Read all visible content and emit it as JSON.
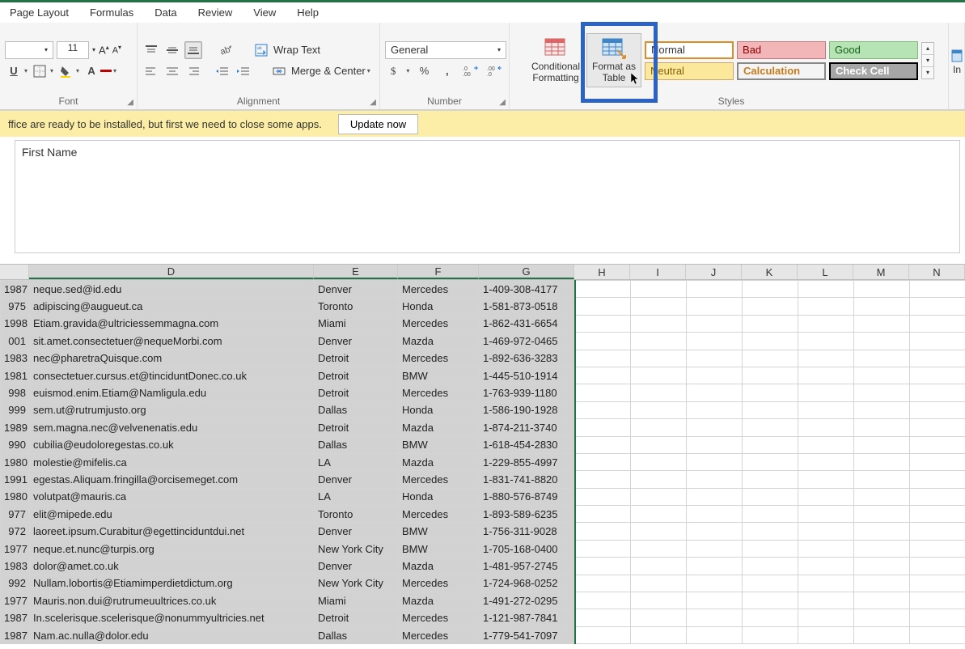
{
  "tabs": [
    "Page Layout",
    "Formulas",
    "Data",
    "Review",
    "View",
    "Help"
  ],
  "ribbon": {
    "font": {
      "size": "11",
      "label": "Font"
    },
    "alignment": {
      "wrap_text": "Wrap Text",
      "merge_center": "Merge & Center",
      "label": "Alignment"
    },
    "number": {
      "format": "General",
      "label": "Number"
    },
    "conditionalFormatting": "Conditional\nFormatting",
    "formatAsTable": "Format as\nTable",
    "styles": {
      "normal": "Normal",
      "bad": "Bad",
      "good": "Good",
      "neutral": "Neutral",
      "calculation": "Calculation",
      "checkcell": "Check Cell",
      "label": "Styles"
    },
    "insert_cut": "In"
  },
  "messagebar": {
    "text": "ffice are ready to be installed, but first we need to close some apps.",
    "button": "Update now"
  },
  "formula_bar_value": "First Name",
  "columns_visible": [
    "",
    "D",
    "E",
    "F",
    "G",
    "H",
    "I",
    "J",
    "K",
    "L",
    "M",
    "N"
  ],
  "rows": [
    {
      "yr": "1987",
      "email": "neque.sed@id.edu",
      "city": "Denver",
      "make": "Mercedes",
      "phone": "1-409-308-4177"
    },
    {
      "yr": "975",
      "email": "adipiscing@augueut.ca",
      "city": "Toronto",
      "make": "Honda",
      "phone": "1-581-873-0518"
    },
    {
      "yr": "1998",
      "email": "Etiam.gravida@ultriciessemmagna.com",
      "city": "Miami",
      "make": "Mercedes",
      "phone": "1-862-431-6654"
    },
    {
      "yr": "001",
      "email": "sit.amet.consectetuer@nequeMorbi.com",
      "city": "Denver",
      "make": "Mazda",
      "phone": "1-469-972-0465"
    },
    {
      "yr": "1983",
      "email": "nec@pharetraQuisque.com",
      "city": "Detroit",
      "make": "Mercedes",
      "phone": "1-892-636-3283"
    },
    {
      "yr": "1981",
      "email": "consectetuer.cursus.et@tinciduntDonec.co.uk",
      "city": "Detroit",
      "make": "BMW",
      "phone": "1-445-510-1914"
    },
    {
      "yr": "998",
      "email": "euismod.enim.Etiam@Namligula.edu",
      "city": "Detroit",
      "make": "Mercedes",
      "phone": "1-763-939-1180"
    },
    {
      "yr": "999",
      "email": "sem.ut@rutrumjusto.org",
      "city": "Dallas",
      "make": "Honda",
      "phone": "1-586-190-1928"
    },
    {
      "yr": "1989",
      "email": "sem.magna.nec@velvenenatis.edu",
      "city": "Detroit",
      "make": "Mazda",
      "phone": "1-874-211-3740"
    },
    {
      "yr": "990",
      "email": "cubilia@eudoloregestas.co.uk",
      "city": "Dallas",
      "make": "BMW",
      "phone": "1-618-454-2830"
    },
    {
      "yr": "1980",
      "email": "molestie@mifelis.ca",
      "city": "LA",
      "make": "Mazda",
      "phone": "1-229-855-4997"
    },
    {
      "yr": "1991",
      "email": "egestas.Aliquam.fringilla@orcisemeget.com",
      "city": "Denver",
      "make": "Mercedes",
      "phone": "1-831-741-8820"
    },
    {
      "yr": "1980",
      "email": "volutpat@mauris.ca",
      "city": "LA",
      "make": "Honda",
      "phone": "1-880-576-8749"
    },
    {
      "yr": "977",
      "email": "elit@mipede.edu",
      "city": "Toronto",
      "make": "Mercedes",
      "phone": "1-893-589-6235"
    },
    {
      "yr": "972",
      "email": "laoreet.ipsum.Curabitur@egettinciduntdui.net",
      "city": "Denver",
      "make": "BMW",
      "phone": "1-756-311-9028"
    },
    {
      "yr": "1977",
      "email": "neque.et.nunc@turpis.org",
      "city": "New York City",
      "make": "BMW",
      "phone": "1-705-168-0400"
    },
    {
      "yr": "1983",
      "email": "dolor@amet.co.uk",
      "city": "Denver",
      "make": "Mazda",
      "phone": "1-481-957-2745"
    },
    {
      "yr": "992",
      "email": "Nullam.lobortis@Etiamimperdietdictum.org",
      "city": "New York City",
      "make": "Mercedes",
      "phone": "1-724-968-0252"
    },
    {
      "yr": "1977",
      "email": "Mauris.non.dui@rutrumeuultrices.co.uk",
      "city": "Miami",
      "make": "Mazda",
      "phone": "1-491-272-0295"
    },
    {
      "yr": "1987",
      "email": "In.scelerisque.scelerisque@nonummyultricies.net",
      "city": "Detroit",
      "make": "Mercedes",
      "phone": "1-121-987-7841"
    },
    {
      "yr": "1987",
      "email": "Nam.ac.nulla@dolor.edu",
      "city": "Dallas",
      "make": "Mercedes",
      "phone": "1-779-541-7097"
    }
  ]
}
